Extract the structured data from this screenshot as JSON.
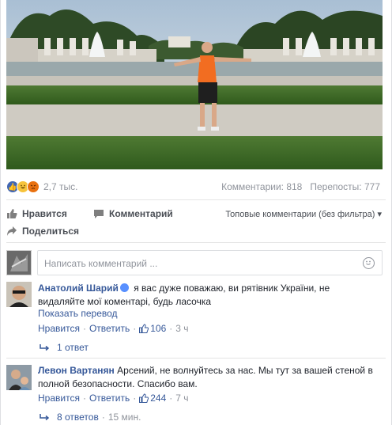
{
  "post": {
    "reaction_count": "2,7 тыс.",
    "comments_stat": "Комментарии: 818",
    "shares_stat": "Перепосты: 777"
  },
  "actions": {
    "like": "Нравится",
    "comment": "Комментарий",
    "share": "Поделиться",
    "sort": "Топовые комментарии (без фильтра)"
  },
  "composer": {
    "placeholder": "Написать комментарий ..."
  },
  "comments": [
    {
      "author": "Анатолий Шарий",
      "text": "я вас дуже поважаю, ви рятівник України, не видаляйте мої коментарі, будь ласочка",
      "translate": "Показать перевод",
      "like": "Нравится",
      "reply": "Ответить",
      "likes": "106",
      "time": "3 ч",
      "replies": "1 ответ",
      "replies_time": ""
    },
    {
      "author": "Левон Вартанян",
      "text": "Арсений, не волнуйтесь за нас. Мы тут за вашей стеной в полной безопасности. Спасибо вам.",
      "like": "Нравится",
      "reply": "Ответить",
      "likes": "244",
      "time": "7 ч",
      "replies": "8 ответов",
      "replies_time": "15 мин."
    }
  ],
  "icons": {
    "reactions": [
      "like-icon",
      "haha-icon",
      "angry-icon"
    ],
    "accent": "#365899",
    "verified_color": "#5890ff"
  }
}
